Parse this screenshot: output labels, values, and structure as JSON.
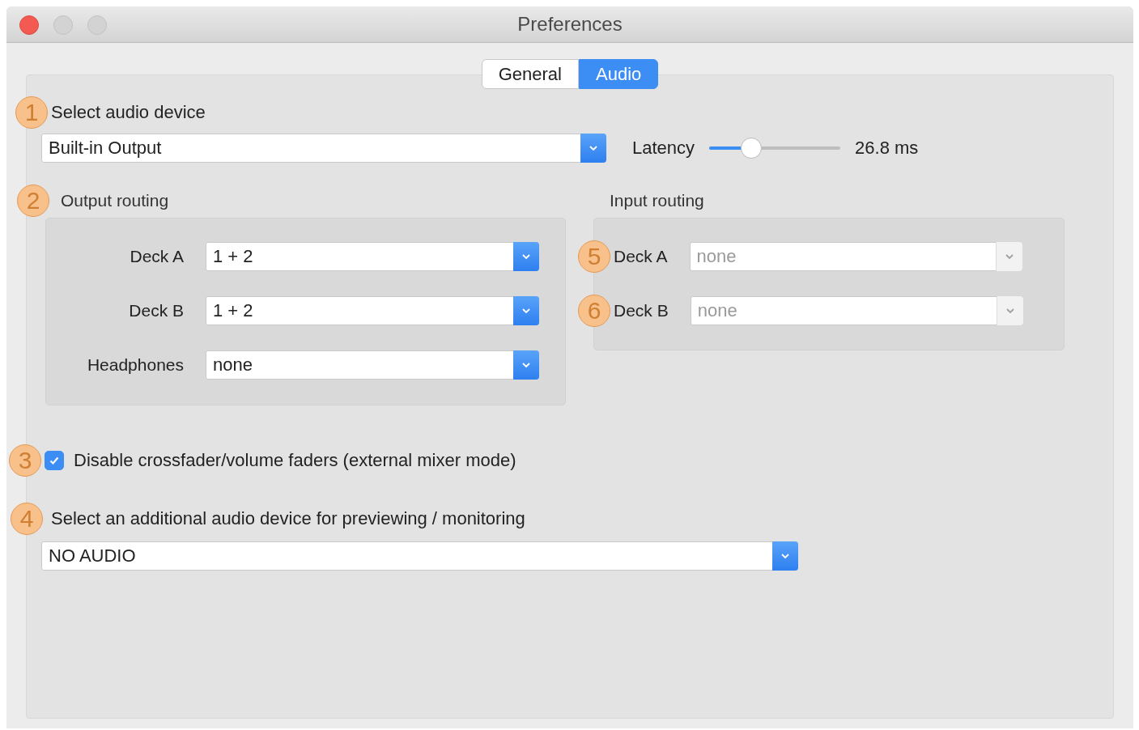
{
  "window": {
    "title": "Preferences"
  },
  "tabs": [
    {
      "label": "General",
      "selected": false
    },
    {
      "label": "Audio",
      "selected": true
    }
  ],
  "audio_device": {
    "callout": "1",
    "label": "Select audio device",
    "value": "Built-in Output"
  },
  "latency": {
    "label": "Latency",
    "level": 0.32,
    "reading": "26.8 ms"
  },
  "output_routing": {
    "callout": "2",
    "title": "Output routing",
    "rows": [
      {
        "label": "Deck A",
        "value": "1 + 2",
        "disabled": false
      },
      {
        "label": "Deck B",
        "value": "1 + 2",
        "disabled": false
      },
      {
        "label": "Headphones",
        "value": "none",
        "disabled": false
      }
    ]
  },
  "input_routing": {
    "title": "Input routing",
    "rows": [
      {
        "callout": "5",
        "label": "Deck A",
        "value": "none",
        "disabled": true
      },
      {
        "callout": "6",
        "label": "Deck B",
        "value": "none",
        "disabled": true
      }
    ]
  },
  "external_mixer": {
    "callout": "3",
    "label": "Disable crossfader/volume faders (external mixer mode)",
    "checked": true
  },
  "preview_device": {
    "callout": "4",
    "label": "Select an additional audio device for previewing / monitoring",
    "value": "NO AUDIO"
  }
}
